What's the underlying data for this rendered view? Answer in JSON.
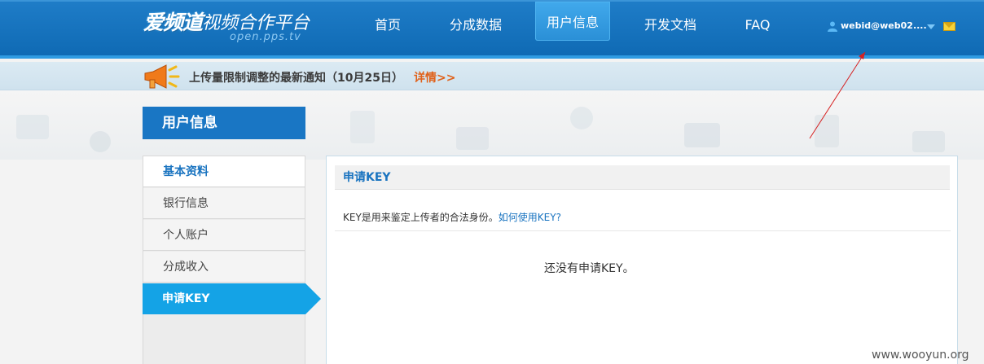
{
  "header": {
    "logo_brand": "爱频道",
    "logo_sub": "视频合作平台",
    "logo_url": "open.pps.tv",
    "nav": [
      "首页",
      "分成数据",
      "用户信息",
      "开发文档",
      "FAQ"
    ],
    "active_nav": "用户信息",
    "user_name": "webid@web02....",
    "user_icon": "user-icon",
    "mail_icon": "mail-icon"
  },
  "notice": {
    "text": "上传量限制调整的最新通知（10月25日）",
    "link": "详情>>",
    "icon": "megaphone-icon"
  },
  "sidebar": {
    "title": "用户信息",
    "items": [
      "基本资料",
      "银行信息",
      "个人账户",
      "分成收入",
      "申请KEY"
    ],
    "active": "申请KEY"
  },
  "main": {
    "title": "申请KEY",
    "desc": "KEY是用来鉴定上传者的合法身份。",
    "desc_link": "如何使用KEY?",
    "empty": "还没有申请KEY。"
  },
  "colors": {
    "header": "#1274bf",
    "sidebar_title": "#1976c4",
    "active_item": "#14a3e6",
    "link": "#1a74c0",
    "notice_link": "#e0611a"
  },
  "watermark": "www.wooyun.org"
}
